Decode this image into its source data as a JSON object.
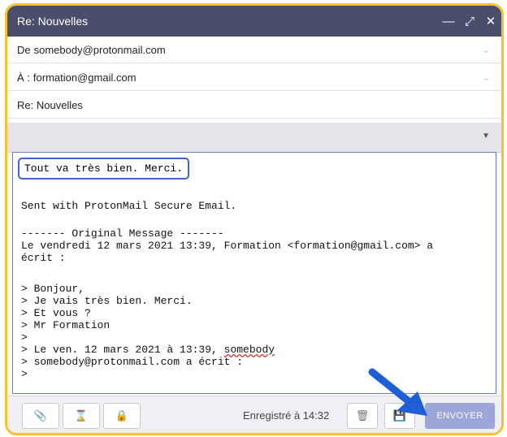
{
  "window": {
    "title": "Re: Nouvelles",
    "controls": [
      "minimize-icon",
      "expand-icon",
      "close-icon"
    ]
  },
  "fields": {
    "from_label": "De",
    "from_value": "somebody@protonmail.com",
    "to_label": "À :",
    "to_value": "formation@gmail.com",
    "subject": "Re: Nouvelles"
  },
  "body": {
    "reply": "Tout va très bien. Merci.",
    "signature": "Sent with ProtonMail Secure Email.",
    "original_header": "------- Original Message -------\nLe vendredi 12 mars 2021 13:39, Formation <formation@gmail.com> a\nécrit :",
    "quote_1": "> Bonjour,\n> Je vais très bien. Merci.\n> Et vous ?\n> Mr Formation\n>\n> Le ven. 12 mars 2021 à 13:39, ",
    "quote_name": "somebody",
    "quote_2": "\n> somebody@protonmail.com a écrit :\n>"
  },
  "footer": {
    "saved_text": "Enregistré à 14:32",
    "send_label": "ENVOYER",
    "icons": [
      "attachment-icon",
      "hourglass-icon",
      "lock-icon",
      "trash-icon",
      "save-icon"
    ]
  },
  "colors": {
    "titlebar": "#4b4e6b",
    "border_highlight": "#f2c230",
    "send_button": "#9da6d8",
    "arrow": "#1f5fd6"
  }
}
